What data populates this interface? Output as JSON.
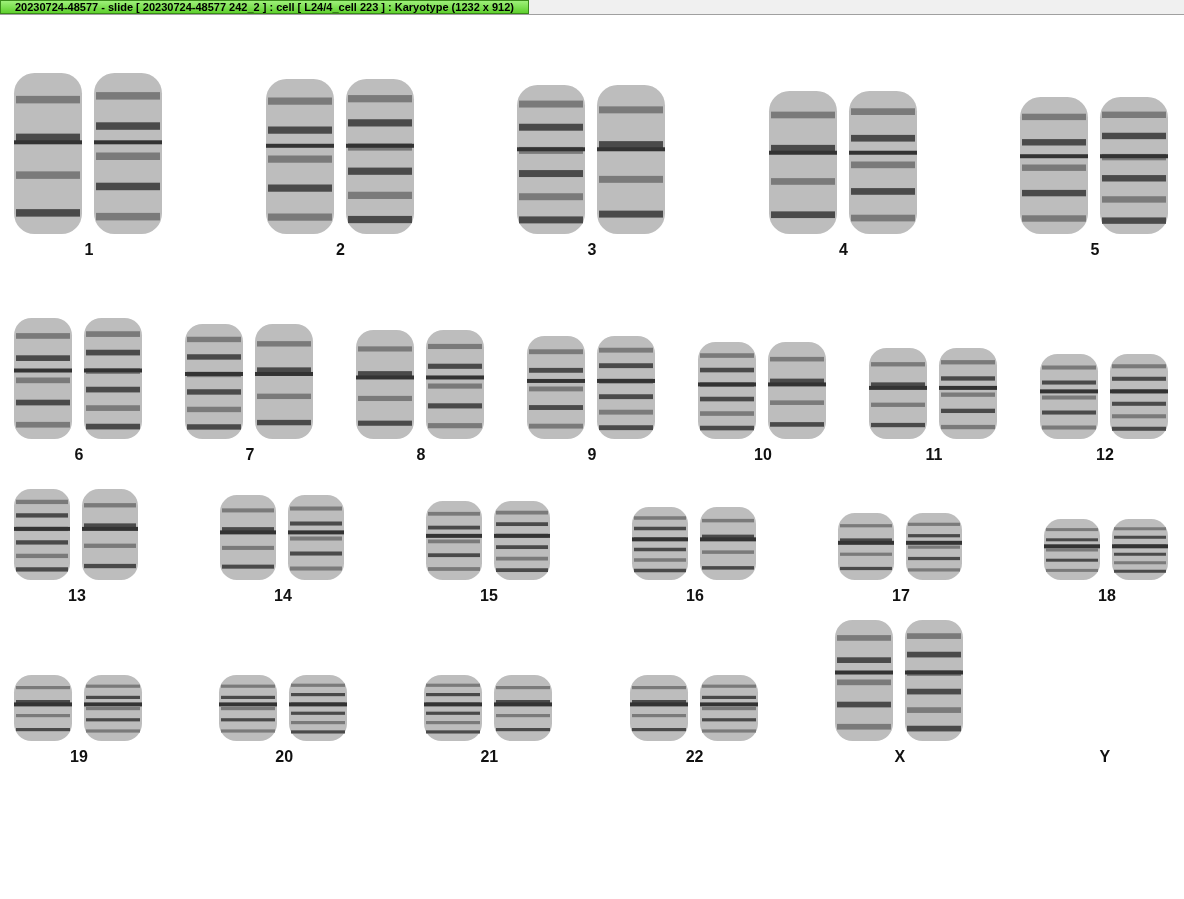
{
  "window": {
    "title": "20230724-48577 - slide [ 20230724-48577 242_2 ] : cell [ L24/4_cell 223 ] : Karyotype  (1232 x 912)"
  },
  "karyotype": {
    "rows": [
      {
        "groups": [
          {
            "label": "1",
            "kind": "pair"
          },
          {
            "label": "2",
            "kind": "pair"
          },
          {
            "label": "3",
            "kind": "pair"
          },
          {
            "label": "4",
            "kind": "pair"
          },
          {
            "label": "5",
            "kind": "pair"
          }
        ]
      },
      {
        "groups": [
          {
            "label": "6",
            "kind": "pair"
          },
          {
            "label": "7",
            "kind": "pair"
          },
          {
            "label": "8",
            "kind": "pair"
          },
          {
            "label": "9",
            "kind": "pair"
          },
          {
            "label": "10",
            "kind": "pair"
          },
          {
            "label": "11",
            "kind": "pair"
          },
          {
            "label": "12",
            "kind": "pair"
          }
        ]
      },
      {
        "groups": [
          {
            "label": "13",
            "kind": "pair"
          },
          {
            "label": "14",
            "kind": "pair"
          },
          {
            "label": "15",
            "kind": "pair"
          },
          {
            "label": "16",
            "kind": "pair"
          },
          {
            "label": "17",
            "kind": "pair"
          },
          {
            "label": "18",
            "kind": "pair"
          }
        ]
      },
      {
        "groups": [
          {
            "label": "19",
            "kind": "pair"
          },
          {
            "label": "20",
            "kind": "pair"
          },
          {
            "label": "21",
            "kind": "pair"
          },
          {
            "label": "22",
            "kind": "pair"
          },
          {
            "label": "X",
            "kind": "pair"
          },
          {
            "label": "Y",
            "kind": "empty"
          }
        ]
      }
    ]
  }
}
